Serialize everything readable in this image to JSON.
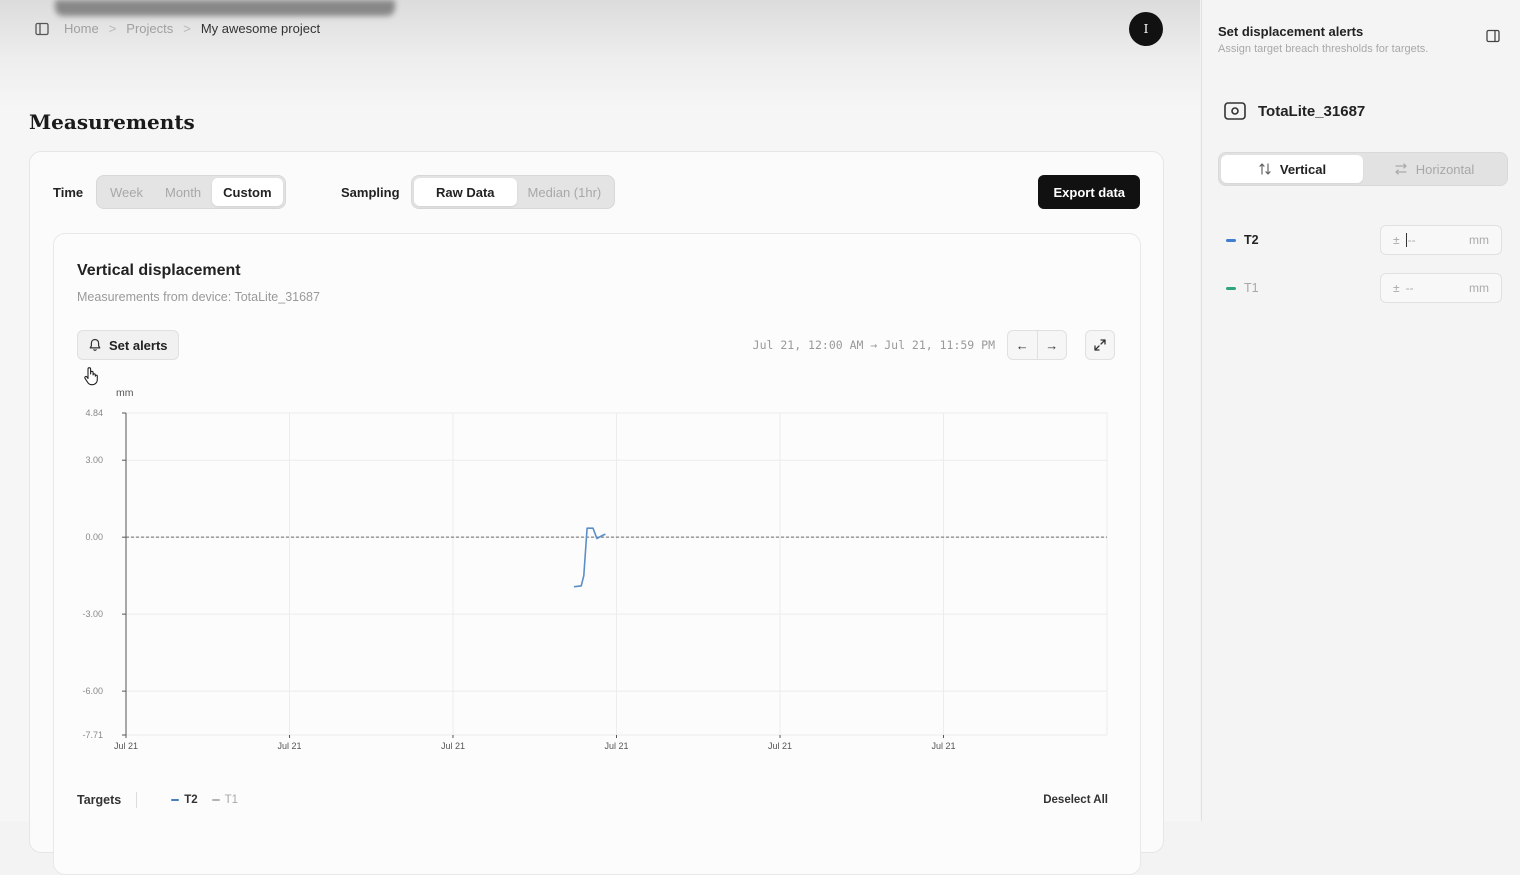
{
  "header": {
    "breadcrumb": [
      "Home",
      "Projects",
      "My awesome project"
    ],
    "breadcrumb_sep": ">",
    "avatar_initial": "I"
  },
  "page": {
    "title": "Measurements"
  },
  "controls": {
    "time_label": "Time",
    "time_options": [
      "Week",
      "Month",
      "Custom"
    ],
    "time_selected": "Custom",
    "sampling_label": "Sampling",
    "sampling_options": [
      "Raw Data",
      "Median (1hr)"
    ],
    "sampling_selected": "Raw Data",
    "export_label": "Export data"
  },
  "chart_card": {
    "title": "Vertical displacement",
    "subtitle": "Measurements from device: TotaLite_31687",
    "set_alerts_label": "Set alerts",
    "range_text": "Jul 21, 12:00 AM → Jul 21, 11:59 PM",
    "prev_symbol": "←",
    "next_symbol": "→"
  },
  "chart_data": {
    "type": "line",
    "ylabel": "mm",
    "ylim": [
      -7.71,
      4.84
    ],
    "y_ticks": [
      "4.84",
      "3.00",
      "0.00",
      "-3.00",
      "-6.00",
      "-7.71"
    ],
    "y_tick_values": [
      4.84,
      3.0,
      0.0,
      -3.0,
      -6.0,
      -7.71
    ],
    "x_ticks": [
      "Jul 21",
      "Jul 21",
      "Jul 21",
      "Jul 21",
      "Jul 21",
      "Jul 21"
    ],
    "x_tick_frac": [
      0,
      0.1667,
      0.3333,
      0.5,
      0.6667,
      0.8333
    ],
    "zero_line": true,
    "grid": true,
    "series": [
      {
        "name": "T2",
        "color": "#5b8fc7",
        "points": [
          [
            0.4567,
            -1.93
          ],
          [
            0.464,
            -1.9
          ],
          [
            0.4667,
            -1.5
          ],
          [
            0.47,
            0.35
          ],
          [
            0.476,
            0.35
          ],
          [
            0.48,
            -0.05
          ],
          [
            0.4847,
            0.05
          ],
          [
            0.4887,
            0.12
          ]
        ]
      },
      {
        "name": "T1",
        "color": "#3aa88e",
        "points": []
      }
    ]
  },
  "targets": {
    "label": "Targets",
    "items": [
      {
        "name": "T2",
        "color": "#4a7fbf",
        "active": true
      },
      {
        "name": "T1",
        "color": "#9aa0a6",
        "active": false
      }
    ],
    "deselect_label": "Deselect All"
  },
  "panel": {
    "title": "Set displacement alerts",
    "subtitle": "Assign target breach thresholds for targets.",
    "device_name": "TotaLite_31687",
    "directions": [
      "Vertical",
      "Horizontal"
    ],
    "direction_selected": "Vertical",
    "thresholds": [
      {
        "name": "T2",
        "color": "#3f7ed0",
        "prefix": "±",
        "value": "--",
        "unit": "mm",
        "active": true
      },
      {
        "name": "T1",
        "color": "#2fa57f",
        "prefix": "±",
        "value": "--",
        "unit": "mm",
        "active": false
      }
    ]
  }
}
